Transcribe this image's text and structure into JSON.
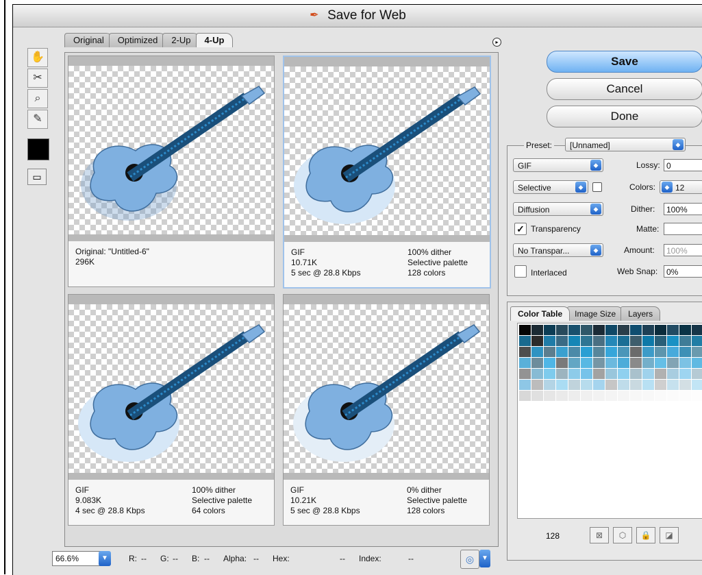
{
  "window": {
    "title": "Save for Web"
  },
  "tabs": [
    {
      "label": "Original"
    },
    {
      "label": "Optimized"
    },
    {
      "label": "2-Up"
    },
    {
      "label": "4-Up"
    }
  ],
  "panes": [
    {
      "info_left": [
        "Original: \"Untitled-6\"",
        "296K",
        ""
      ],
      "info_right": [
        "",
        "",
        ""
      ]
    },
    {
      "info_left": [
        "GIF",
        "10.71K",
        "5 sec @ 28.8 Kbps"
      ],
      "info_right": [
        "100% dither",
        "Selective palette",
        "128 colors"
      ]
    },
    {
      "info_left": [
        "GIF",
        "9.083K",
        "4 sec @ 28.8 Kbps"
      ],
      "info_right": [
        "100% dither",
        "Selective palette",
        "64 colors"
      ]
    },
    {
      "info_left": [
        "GIF",
        "10.21K",
        "5 sec @ 28.8 Kbps"
      ],
      "info_right": [
        "0% dither",
        "Selective palette",
        "128 colors"
      ]
    }
  ],
  "buttons": {
    "save": "Save",
    "cancel": "Cancel",
    "done": "Done"
  },
  "settings": {
    "preset_label": "Preset:",
    "preset_value": "[Unnamed]",
    "format_value": "GIF",
    "lossy_label": "Lossy:",
    "lossy_value": "0",
    "palette_value": "Selective",
    "colors_label": "Colors:",
    "colors_value": "12",
    "dither_algo_value": "Diffusion",
    "dither_label": "Dither:",
    "dither_value": "100%",
    "transparency_label": "Transparency",
    "transparency_checked": true,
    "matte_label": "Matte:",
    "matte_value": "",
    "transp_dither_value": "No Transpar...",
    "amount_label": "Amount:",
    "amount_value": "100%",
    "interlaced_label": "Interlaced",
    "interlaced_checked": false,
    "websnap_label": "Web Snap:",
    "websnap_value": "0%"
  },
  "color_table": {
    "tabs": [
      {
        "label": "Color Table"
      },
      {
        "label": "Image Size"
      },
      {
        "label": "Layers"
      }
    ],
    "count": "128",
    "swatches": [
      "#050505",
      "#1b2a33",
      "#0d3d55",
      "#274a5c",
      "#19516e",
      "#2f5769",
      "#1c2b36",
      "#0f4866",
      "#2a3e4a",
      "#104e70",
      "#1e4055",
      "#0b2c3c",
      "#214b63",
      "#0a3346",
      "#163548",
      "#1a6a8f",
      "#2b2b2b",
      "#1f7ca8",
      "#3a6b85",
      "#1586b6",
      "#2f7593",
      "#4a6f82",
      "#2488b8",
      "#1b6e95",
      "#3e5d6c",
      "#0e79a8",
      "#295f78",
      "#1a91c4",
      "#3f7c97",
      "#217da5",
      "#4d4d4d",
      "#2f93c2",
      "#5c7e8f",
      "#3aa0cf",
      "#4c8aa8",
      "#2a9fd3",
      "#57869b",
      "#36a6da",
      "#4b96b9",
      "#6b6b6b",
      "#3d9bc8",
      "#5d95ad",
      "#48aadb",
      "#3e90b6",
      "#6a9aae",
      "#5ab0d9",
      "#6d8d9c",
      "#4fb6e6",
      "#7a7a7a",
      "#63a6c4",
      "#58b8e3",
      "#7696a5",
      "#6bb9de",
      "#4dacd9",
      "#8a8a8a",
      "#74afca",
      "#66bfe6",
      "#82a4b4",
      "#7cc2e4",
      "#5fb9e2",
      "#939393",
      "#87bbd4",
      "#7ecbed",
      "#9cb4bf",
      "#8dcbe9",
      "#76c3ea",
      "#a2a2a2",
      "#99c6dc",
      "#8fd0ef",
      "#a9c1cc",
      "#9fd2ec",
      "#b1b1b1",
      "#a8cde0",
      "#9ed5f1",
      "#b5cad4",
      "#8ec7e6",
      "#bcbcbc",
      "#b3d4e5",
      "#aadcf3",
      "#c0d3dc",
      "#b7dced",
      "#a5d4ee",
      "#c6c6c6",
      "#bfdcea",
      "#c9d9e0",
      "#b8e0f3",
      "#cfcfcf",
      "#c6e1ee",
      "#d3dfe4",
      "#c2e5f5",
      "#d8d8d8",
      "#e0e0e0",
      "#e6e6e6",
      "#eaeaea",
      "#ededed",
      "#f0f0f0",
      "#f2f2f2",
      "#f4f4f4",
      "#f5f5f5",
      "#f7f7f7",
      "#f8f8f8",
      "#fafafa",
      "#fbfbfb",
      "#fcfcfc",
      "#fdfdfd"
    ]
  },
  "status": {
    "zoom": "66.6%",
    "r_label": "R:",
    "r_value": "--",
    "g_label": "G:",
    "g_value": "--",
    "b_label": "B:",
    "b_value": "--",
    "alpha_label": "Alpha:",
    "alpha_value": "--",
    "hex_label": "Hex:",
    "hex_value": "--",
    "index_label": "Index:",
    "index_value": "--"
  }
}
